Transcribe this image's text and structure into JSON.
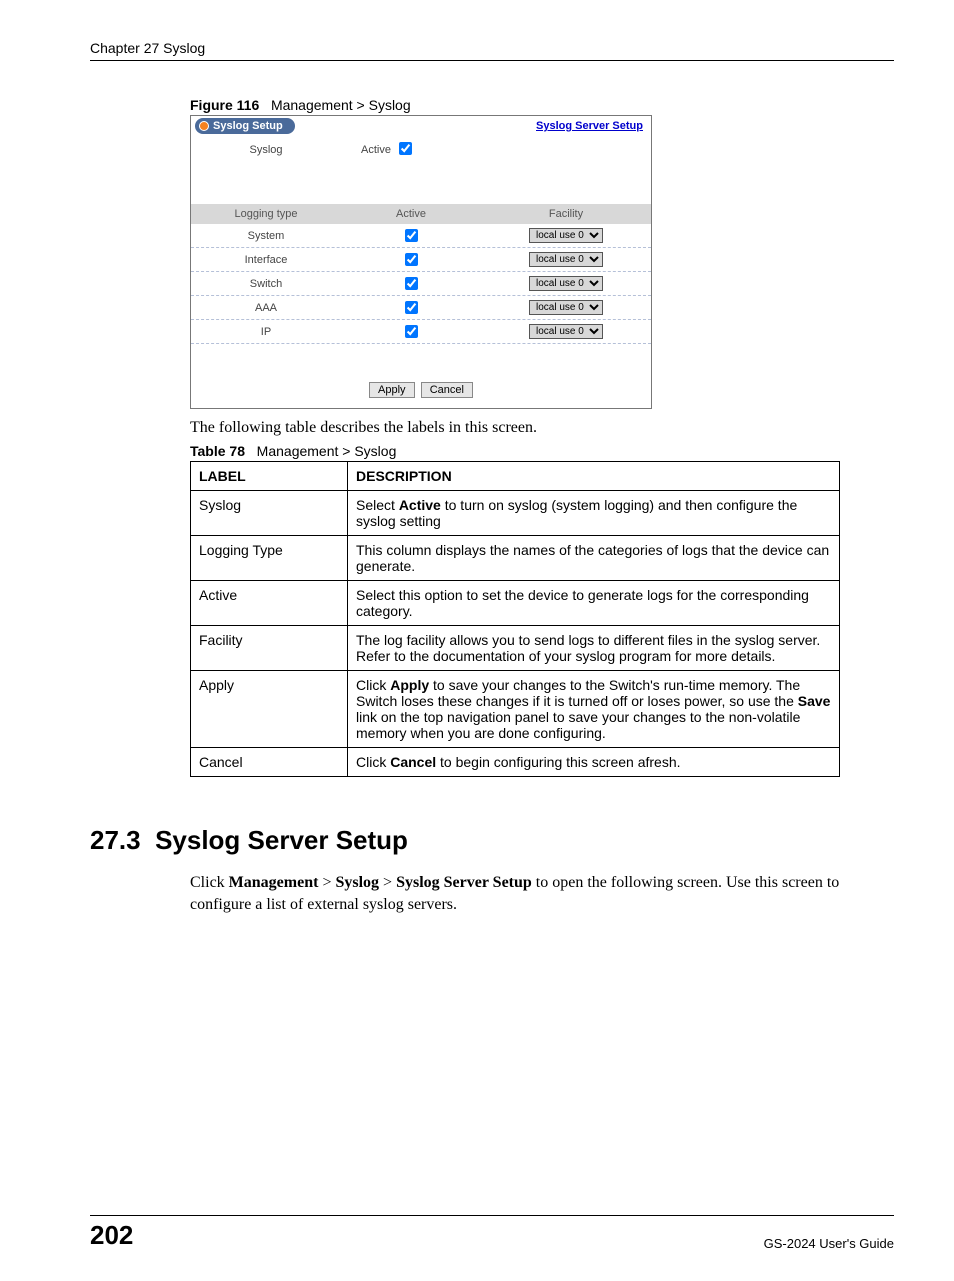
{
  "header": {
    "chapter": "Chapter 27 Syslog"
  },
  "figure": {
    "label": "Figure 116",
    "title": "Management > Syslog"
  },
  "screenshot": {
    "tab_title": "Syslog Setup",
    "link": "Syslog Server Setup",
    "syslog_label": "Syslog",
    "active_label": "Active",
    "thead": {
      "c1": "Logging type",
      "c2": "Active",
      "c3": "Facility"
    },
    "rows": [
      {
        "name": "System",
        "facility": "local use 0"
      },
      {
        "name": "Interface",
        "facility": "local use 0"
      },
      {
        "name": "Switch",
        "facility": "local use 0"
      },
      {
        "name": "AAA",
        "facility": "local use 0"
      },
      {
        "name": "IP",
        "facility": "local use 0"
      }
    ],
    "apply": "Apply",
    "cancel": "Cancel"
  },
  "intro_text": "The following table describes the labels in this screen.",
  "table": {
    "label": "Table 78",
    "title": "Management > Syslog",
    "head": {
      "c1": "LABEL",
      "c2": "DESCRIPTION"
    },
    "rows": [
      {
        "label": "Syslog",
        "desc_pre": "Select ",
        "desc_b1": "Active",
        "desc_post": " to turn on syslog (system logging) and then configure the syslog setting"
      },
      {
        "label": "Logging Type",
        "desc": "This column displays the names of the categories of logs that the device can generate."
      },
      {
        "label": "Active",
        "desc": "Select this option to set the device to generate logs for the corresponding category."
      },
      {
        "label": "Facility",
        "desc": "The log facility allows you to send logs to different files in the syslog server. Refer to the documentation of your syslog program for more details."
      },
      {
        "label": "Apply",
        "desc_pre": "Click ",
        "desc_b1": "Apply",
        "desc_mid": " to save your changes to the Switch's run-time memory. The Switch loses these changes if it is turned off or loses power, so use the ",
        "desc_b2": "Save",
        "desc_post": " link on the top navigation panel to save your changes to the non-volatile memory when you are done configuring."
      },
      {
        "label": "Cancel",
        "desc_pre": "Click ",
        "desc_b1": "Cancel",
        "desc_post": " to begin configuring this screen afresh."
      }
    ]
  },
  "section": {
    "number": "27.3",
    "title": "Syslog Server Setup",
    "body_pre": "Click ",
    "b1": "Management",
    "sep1": " > ",
    "b2": "Syslog",
    "sep2": " > ",
    "b3": "Syslog Server Setup",
    "body_post": " to open the following screen. Use this screen to configure a list of external syslog servers."
  },
  "footer": {
    "page": "202",
    "guide": "GS-2024 User's Guide"
  }
}
